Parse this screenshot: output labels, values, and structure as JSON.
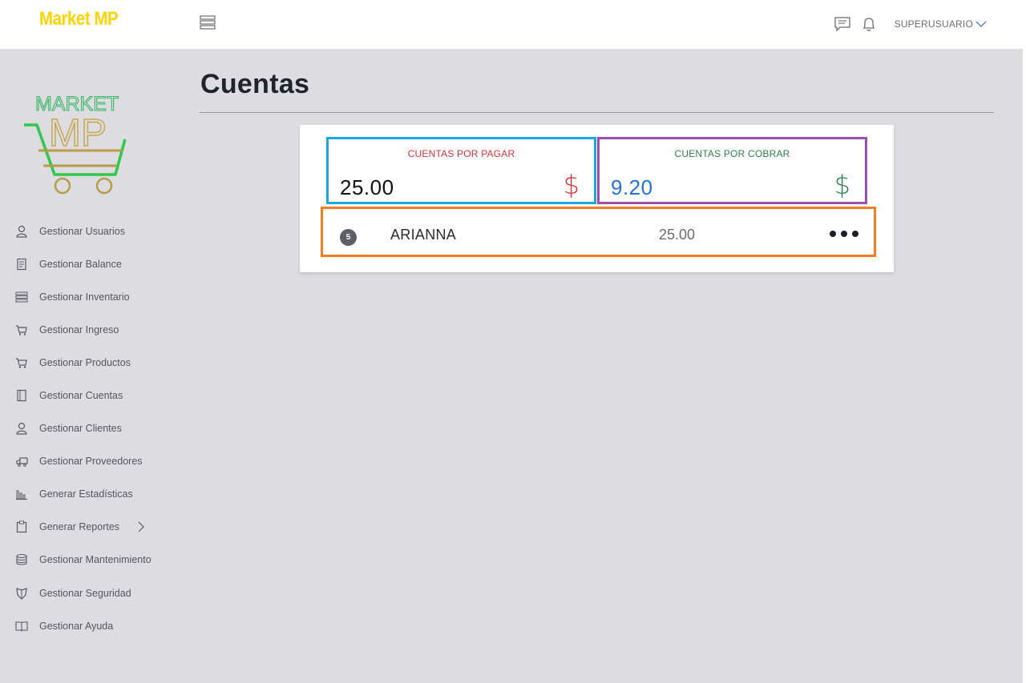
{
  "header": {
    "brand": "Market MP",
    "user_label": "SUPERUSUARIO"
  },
  "sidebar": {
    "logo_text": [
      "MARKET",
      "MP"
    ],
    "items": [
      {
        "label": "Gestionar Usuarios",
        "icon": "user-icon"
      },
      {
        "label": "Gestionar Balance",
        "icon": "receipt-icon"
      },
      {
        "label": "Gestionar Inventario",
        "icon": "list-icon"
      },
      {
        "label": "Gestionar Ingreso",
        "icon": "cart-icon"
      },
      {
        "label": "Gestionar Productos",
        "icon": "cart-icon"
      },
      {
        "label": "Gestionar Cuentas",
        "icon": "book-icon"
      },
      {
        "label": "Gestionar Clientes",
        "icon": "user-icon"
      },
      {
        "label": "Gestionar Proveedores",
        "icon": "truck-icon"
      },
      {
        "label": "Generar Estadísticas",
        "icon": "bar-chart-icon"
      },
      {
        "label": "Generar Reportes",
        "icon": "clipboard-icon"
      },
      {
        "label": "Gestionar Mantenimiento",
        "icon": "database-icon"
      },
      {
        "label": "Gestionar Seguridad",
        "icon": "shield-icon"
      },
      {
        "label": "Gestionar Ayuda",
        "icon": "open-book-icon"
      }
    ]
  },
  "main": {
    "title": "Cuentas",
    "summary": {
      "pagar": {
        "label": "CUENTAS POR PAGAR",
        "value": "25.00",
        "currency": "$"
      },
      "cobrar": {
        "label": "CUENTAS POR COBRAR",
        "value": "9.20",
        "currency": "$"
      }
    },
    "accounts": [
      {
        "badge": "5",
        "name": "ARIANNA",
        "amount": "25.00"
      }
    ]
  },
  "colors": {
    "brand": "#ffd400",
    "pagar_border": "#1da6e0",
    "cobrar_border": "#9b4fb0",
    "row_border": "#f07f24",
    "pagar_text": "#d0333b",
    "cobrar_text": "#2f7d4c",
    "cobrar_value": "#2a6fe0"
  }
}
